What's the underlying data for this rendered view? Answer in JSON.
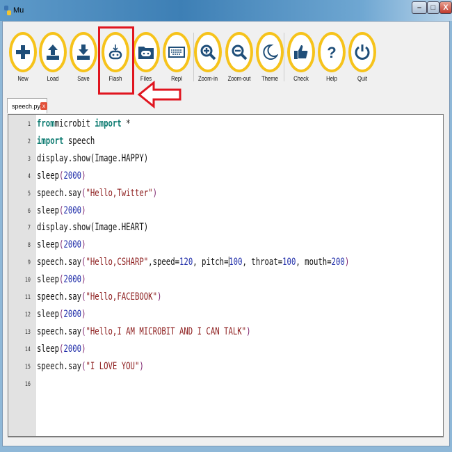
{
  "window": {
    "title": "Mu",
    "min": "–",
    "max": "□",
    "close": "X"
  },
  "toolbar": [
    {
      "id": "new",
      "label": "New",
      "icon": "plus-icon"
    },
    {
      "id": "load",
      "label": "Load",
      "icon": "upload-icon"
    },
    {
      "id": "save",
      "label": "Save",
      "icon": "download-icon"
    },
    {
      "id": "flash",
      "label": "Flash",
      "icon": "microbit-flash-icon"
    },
    {
      "id": "files",
      "label": "Files",
      "icon": "folder-microbit-icon"
    },
    {
      "id": "repl",
      "label": "Repl",
      "icon": "keyboard-icon"
    },
    {
      "id": "zoom-in",
      "label": "Zoom-in",
      "icon": "zoom-in-icon"
    },
    {
      "id": "zoom-out",
      "label": "Zoom-out",
      "icon": "zoom-out-icon"
    },
    {
      "id": "theme",
      "label": "Theme",
      "icon": "moon-icon"
    },
    {
      "id": "check",
      "label": "Check",
      "icon": "thumbs-up-icon"
    },
    {
      "id": "help",
      "label": "Help",
      "icon": "question-icon"
    },
    {
      "id": "quit",
      "label": "Quit",
      "icon": "power-icon"
    }
  ],
  "tab": {
    "label": "speech.py *",
    "close": "x"
  },
  "colors": {
    "accent": "#f6c31b",
    "icon": "#1f4e79",
    "highlight": "#e0151f"
  },
  "editor": {
    "lines": [
      [
        [
          "k",
          "from"
        ],
        [
          "",
          "microbit "
        ],
        [
          "k",
          "import"
        ],
        [
          "",
          " *"
        ]
      ],
      [
        [
          "k",
          "import"
        ],
        [
          "",
          " speech"
        ]
      ],
      [
        [
          "",
          "display.show(Image.HAPPY)"
        ]
      ],
      [
        [
          "",
          "sleep"
        ],
        [
          "p",
          "("
        ],
        [
          "n",
          "2000"
        ],
        [
          "p",
          ")"
        ]
      ],
      [
        [
          "",
          "speech.say"
        ],
        [
          "p",
          "("
        ],
        [
          "s",
          "\"Hello,Twitter\""
        ],
        [
          "p",
          ")"
        ]
      ],
      [
        [
          "",
          "sleep"
        ],
        [
          "p",
          "("
        ],
        [
          "n",
          "2000"
        ],
        [
          "p",
          ")"
        ]
      ],
      [
        [
          "",
          "display.show(Image.HEART)"
        ]
      ],
      [
        [
          "",
          "sleep"
        ],
        [
          "p",
          "("
        ],
        [
          "n",
          "2000"
        ],
        [
          "p",
          ")"
        ]
      ],
      [
        [
          "",
          "speech.say"
        ],
        [
          "p",
          "("
        ],
        [
          "s",
          "\"Hello,CSHARP\""
        ],
        [
          "",
          ",speed="
        ],
        [
          "n",
          "120"
        ],
        [
          "",
          ", pitch="
        ],
        [
          "caret",
          ""
        ],
        [
          "n",
          "100"
        ],
        [
          "",
          ", throat="
        ],
        [
          "n",
          "100"
        ],
        [
          "",
          ", mouth="
        ],
        [
          "n",
          "200"
        ],
        [
          "p",
          ")"
        ]
      ],
      [
        [
          "",
          "sleep"
        ],
        [
          "p",
          "("
        ],
        [
          "n",
          "2000"
        ],
        [
          "p",
          ")"
        ]
      ],
      [
        [
          "",
          "speech.say"
        ],
        [
          "p",
          "("
        ],
        [
          "s",
          "\"Hello,FACEBOOK\""
        ],
        [
          "p",
          ")"
        ]
      ],
      [
        [
          "",
          "sleep"
        ],
        [
          "p",
          "("
        ],
        [
          "n",
          "2000"
        ],
        [
          "p",
          ")"
        ]
      ],
      [
        [
          "",
          "speech.say"
        ],
        [
          "p",
          "("
        ],
        [
          "s",
          "\"Hello,I AM MICROBIT AND I CAN TALK\""
        ],
        [
          "p",
          ")"
        ]
      ],
      [
        [
          "",
          "sleep"
        ],
        [
          "p",
          "("
        ],
        [
          "n",
          "2000"
        ],
        [
          "p",
          ")"
        ]
      ],
      [
        [
          "",
          "speech.say"
        ],
        [
          "p",
          "("
        ],
        [
          "s",
          "\"I LOVE YOU\""
        ],
        [
          "p",
          ")"
        ]
      ],
      []
    ],
    "line_numbers": [
      "1",
      "2",
      "3",
      "4",
      "5",
      "6",
      "7",
      "8",
      "9",
      "10",
      "11",
      "12",
      "13",
      "14",
      "15",
      "16"
    ]
  }
}
